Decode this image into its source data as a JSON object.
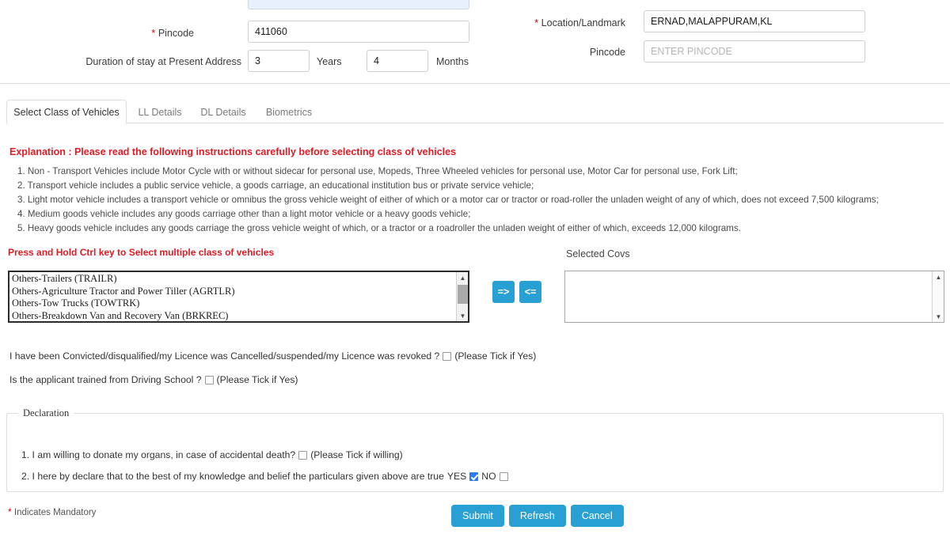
{
  "address_section": {
    "fields": [
      {
        "label": "Pincode",
        "required": true,
        "value": "411060",
        "placeholder": ""
      },
      {
        "label": "Duration of stay at Present Address",
        "required": false,
        "value": "3",
        "placeholder": ""
      },
      {
        "label": "Location/Landmark",
        "required": true,
        "value": "ERNAD,MALAPPURAM,KL",
        "placeholder": ""
      },
      {
        "label": "Pincode",
        "required": false,
        "value": "",
        "placeholder": "ENTER PINCODE"
      }
    ],
    "duration_years_value": "3",
    "duration_years_unit": "Years",
    "duration_months_value": "4",
    "duration_months_unit": "Months"
  },
  "tabs": [
    {
      "label": "Select Class of Vehicles",
      "active": true
    },
    {
      "label": "LL Details",
      "active": false
    },
    {
      "label": "DL Details",
      "active": false
    },
    {
      "label": "Biometrics",
      "active": false
    }
  ],
  "explanation": {
    "title": "Explanation : Please read the following instructions carefully before selecting class of vehicles",
    "items": [
      "1. Non - Transport Vehicles include Motor Cycle with or without sidecar for personal use, Mopeds, Three Wheeled vehicles for personal use, Motor Car for personal use, Fork Lift;",
      "2. Transport vehicle includes a public service vehicle, a goods carriage, an educational institution bus or private service vehicle;",
      "3. Light motor vehicle includes a transport vehicle or omnibus the gross vehicle weight of either of which or a motor car or tractor or road-roller the unladen weight of any of which, does not exceed 7,500 kilograms;",
      "4. Medium goods vehicle includes any goods carriage other than a light motor vehicle or a heavy goods vehicle;",
      "5. Heavy goods vehicle includes any goods carriage the gross vehicle weight of which, or a tractor or a roadroller the unladen weight of either of which, exceeds 12,000 kilograms."
    ],
    "ctrl_note": "Press and Hold Ctrl key to Select multiple class of vehicles"
  },
  "cov_picker": {
    "available_options": [
      "Others-Trailers (TRAILR)",
      "Others-Agriculture Tractor and Power Tiller (AGRTLR)",
      "Others-Tow Trucks (TOWTRK)",
      "Others-Breakdown Van and Recovery Van (BRKREC)"
    ],
    "add_button_label": "=>",
    "remove_button_label": "<=",
    "selected_label": "Selected Covs",
    "selected_options": []
  },
  "questions": [
    {
      "text": "I have been Convicted/disqualified/my Licence was Cancelled/suspended/my Licence was revoked ?",
      "hint": "(Please Tick if Yes)",
      "checked": false
    },
    {
      "text": "Is the applicant trained from Driving School ?",
      "hint": "(Please Tick if Yes)",
      "checked": false
    }
  ],
  "declaration": {
    "legend": "Declaration",
    "item1_text": "1. I am willing to donate my organs, in case of accidental death?",
    "item1_hint": "(Please Tick if willing)",
    "item1_checked": false,
    "item2_text": "2. I here by declare that to the best of my knowledge and belief the particulars given above are true",
    "item2_yes_label": "YES",
    "item2_yes_checked": true,
    "item2_no_label": "NO",
    "item2_no_checked": false
  },
  "footer": {
    "mandatory_note": "Indicates Mandatory",
    "submit_label": "Submit",
    "refresh_label": "Refresh",
    "cancel_label": "Cancel"
  },
  "colors": {
    "accent_blue": "#29a0d4",
    "error_red": "#e01b24",
    "required_star": "#d0021b",
    "checked_blue": "#2b7de9"
  }
}
